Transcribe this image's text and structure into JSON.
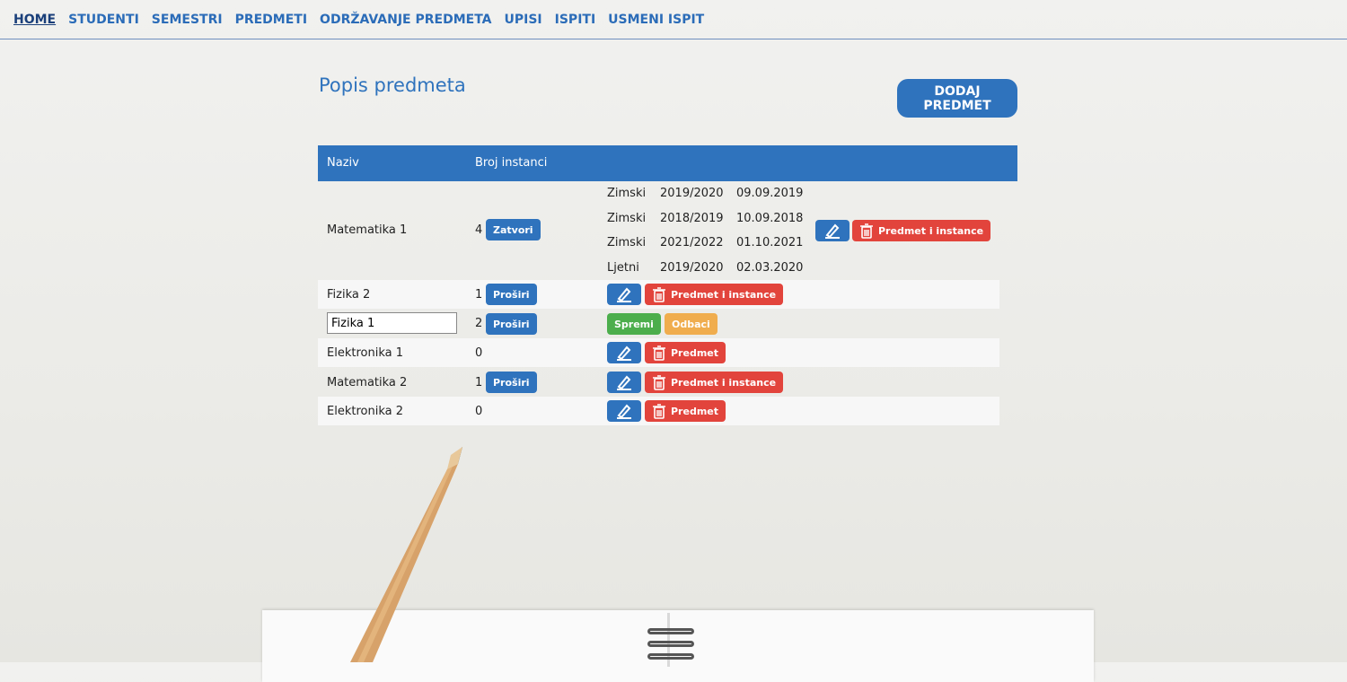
{
  "nav": {
    "items": [
      "HOME",
      "STUDENTI",
      "SEMESTRI",
      "PREDMETI",
      "ODRŽAVANJE PREDMETA",
      "UPISI",
      "ISPITI",
      "USMENI ISPIT"
    ]
  },
  "page": {
    "title": "Popis predmeta",
    "add_button": "DODAJ PREDMET"
  },
  "table": {
    "headers": [
      "Naziv",
      "Broj instanci"
    ],
    "rows": [
      {
        "name": "Matematika 1",
        "count": "4",
        "toggle": "Zatvori",
        "instances": [
          {
            "term": "Zimski",
            "year": "2019/2020",
            "date": "09.09.2019"
          },
          {
            "term": "Zimski",
            "year": "2018/2019",
            "date": "10.09.2018"
          },
          {
            "term": "Zimski",
            "year": "2021/2022",
            "date": "01.10.2021"
          },
          {
            "term": "Ljetni",
            "year": "2019/2020",
            "date": "02.03.2020"
          }
        ],
        "delete_label": "Predmet i instance"
      },
      {
        "name": "Fizika 2",
        "count": "1",
        "toggle": "Proširi",
        "delete_label": "Predmet i instance"
      },
      {
        "name": "Fizika 1",
        "count": "2",
        "toggle": "Proširi",
        "save_label": "Spremi",
        "discard_label": "Odbaci"
      },
      {
        "name": "Elektronika 1",
        "count": "0",
        "delete_label": "Predmet"
      },
      {
        "name": "Matematika 2",
        "count": "1",
        "toggle": "Proširi",
        "delete_label": "Predmet i instance"
      },
      {
        "name": "Elektronika 2",
        "count": "0",
        "delete_label": "Predmet"
      }
    ]
  },
  "icons": {
    "edit": "edit-icon",
    "delete": "trash-icon"
  },
  "colors": {
    "primary": "#2f73bd",
    "danger": "#e2443c",
    "success": "#4cae4c",
    "warning": "#f0ad4e"
  }
}
